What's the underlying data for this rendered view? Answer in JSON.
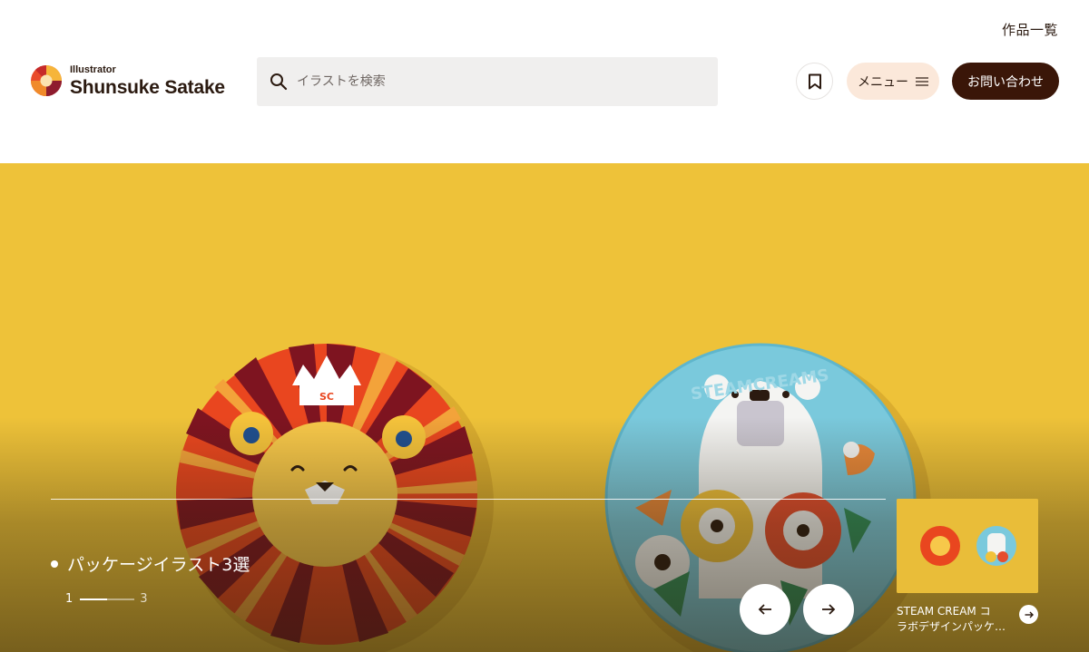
{
  "nav": {
    "works_link": "作品一覧"
  },
  "logo": {
    "subtitle": "Illustrator",
    "name": "Shunsuke Satake"
  },
  "search": {
    "placeholder": "イラストを検索",
    "value": ""
  },
  "header": {
    "menu_label": "メニュー",
    "contact_label": "お問い合わせ"
  },
  "hero": {
    "slide_title": "パッケージイラスト3選",
    "pager": {
      "current": "1",
      "total": "3",
      "progress": 0.5
    },
    "next_slide": {
      "caption_line1": "STEAM CREAM コ",
      "caption_line2": "ラボデザインパッケ…"
    },
    "tin_lettering": {
      "left": "SC",
      "right": "STEAMCREAMS"
    }
  },
  "colors": {
    "accent_dark": "#3a1608",
    "menu_bg": "#fbe8da",
    "hero_bg": "#eec239",
    "search_bg": "#f0efee"
  },
  "icons": {
    "search": "search-icon",
    "bookmark": "bookmark-icon",
    "menu": "hamburger-icon",
    "prev": "arrow-left-icon",
    "next": "arrow-right-icon"
  }
}
